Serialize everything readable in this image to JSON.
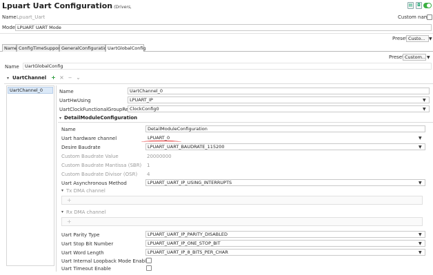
{
  "header": {
    "title": "Lpuart Uart Configuration",
    "subtitle": "(Drivers,",
    "name_label": "Name",
    "name_value": "Lpuart_Uart",
    "custom_name_label": "Custom name",
    "mode_label": "Mode",
    "mode_value": "LPUART UART Mode"
  },
  "preset_bar_1": {
    "label": "Preset",
    "value": "Custo..."
  },
  "tabs": [
    {
      "label": "Name"
    },
    {
      "label": "ConfigTimeSupport"
    },
    {
      "label": "GeneralConfiguration"
    },
    {
      "label": "UartGlobalConfig"
    }
  ],
  "preset_bar_2": {
    "label": "Preset",
    "value": "Custom..."
  },
  "global_config": {
    "name_label": "Name",
    "name_value": "UartGlobalConfig"
  },
  "uart_channel": {
    "heading": "UartChannel",
    "toolbar": {
      "add": "+",
      "remove": "×",
      "up": "‒",
      "down": "⌄"
    },
    "list": [
      "UartChannel_0"
    ],
    "props": [
      {
        "label": "Name",
        "value": "UartChannel_0",
        "dropdown": false
      },
      {
        "label": "UartHwUsing",
        "value": "LPUART_IP",
        "dropdown": true
      },
      {
        "label": "UartClockFunctionalGroupRef",
        "value": "ClockConfig0",
        "dropdown": true
      }
    ]
  },
  "detail": {
    "heading": "DetailModuleConfiguration",
    "rows": [
      {
        "label": "Name",
        "value": "DetailModuleConfiguration",
        "dropdown": false,
        "disabled": false
      },
      {
        "label": "Uart hardware channel",
        "value": "LPUART_0",
        "dropdown": true,
        "disabled": false
      },
      {
        "label": "Desire Baudrate",
        "value": "LPUART_UART_BAUDRATE_115200",
        "dropdown": true,
        "disabled": false
      },
      {
        "label": "Custom Baudrate Value",
        "value": "20000000",
        "dropdown": false,
        "disabled": true
      },
      {
        "label": "Custom Baudrate Mantissa (SBR)",
        "value": "1",
        "dropdown": false,
        "disabled": true
      },
      {
        "label": "Custom Baudrate Divisor (OSR)",
        "value": "4",
        "dropdown": false,
        "disabled": true
      },
      {
        "label": "Uart Asynchronous Method",
        "value": "LPUART_UART_IP_USING_INTERRUPTS",
        "dropdown": true,
        "disabled": false
      }
    ],
    "tx_dma": {
      "heading": "Tx DMA channel",
      "add": "+"
    },
    "rx_dma": {
      "heading": "Rx DMA channel",
      "add": "+"
    },
    "rows2": [
      {
        "label": "Uart Parity Type",
        "value": "LPUART_UART_IP_PARITY_DISABLED"
      },
      {
        "label": "Uart Stop Bit Number",
        "value": "LPUART_UART_IP_ONE_STOP_BIT"
      },
      {
        "label": "Uart Word Length",
        "value": "LPUART_UART_IP_8_BITS_PER_CHAR"
      }
    ],
    "checks": [
      {
        "label": "Uart Internal Loopback Mode Enable",
        "checked": false
      },
      {
        "label": "Uart Timeout Enable",
        "checked": false
      }
    ]
  },
  "dropdown_glyph": "▼",
  "colors": {
    "toggle": "#3cb043",
    "annotation": "#e02020",
    "selection": "#dbe9f8"
  }
}
